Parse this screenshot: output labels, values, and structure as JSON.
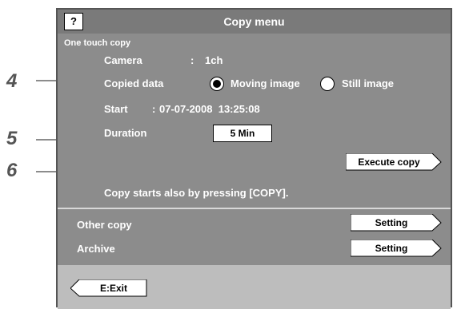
{
  "window": {
    "help_label": "?",
    "title": "Copy menu"
  },
  "one_touch": {
    "section_label": "One touch copy",
    "camera_label": "Camera",
    "camera_sep": ":",
    "camera_value": "1ch",
    "copied_data_label": "Copied data",
    "option_moving": "Moving image",
    "option_still": "Still image",
    "selected_option": "Moving image",
    "start_label": "Start",
    "start_sep": ":",
    "start_value": "07-07-2008  13:25:08",
    "duration_label": "Duration",
    "duration_value": "5 Min",
    "execute_label": "Execute copy",
    "hint": "Copy starts also by pressing [COPY]."
  },
  "other": {
    "other_copy_label": "Other copy",
    "other_copy_button": "Setting",
    "archive_label": "Archive",
    "archive_button": "Setting"
  },
  "footer": {
    "exit_label": "E:Exit"
  },
  "callouts": {
    "c4": "4",
    "c5": "5",
    "c6": "6"
  },
  "colors": {
    "panel": "#8c8c8c",
    "title_bar": "#7a7a7a",
    "footer": "#bdbdbd",
    "callout": "#555555"
  }
}
